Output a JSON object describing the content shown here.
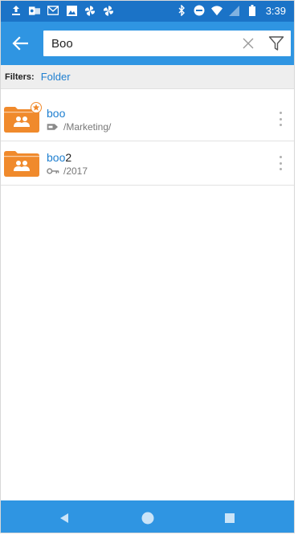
{
  "status_bar": {
    "time": "3:39",
    "left_icons": [
      "upload-icon",
      "outlook-icon",
      "gmail-icon",
      "image-icon",
      "pinwheel-icon",
      "pinwheel-icon"
    ],
    "right_icons": [
      "bluetooth-icon",
      "do-not-disturb-icon",
      "wifi-icon",
      "signal-icon",
      "battery-icon"
    ]
  },
  "app_bar": {
    "search_value": "Boo",
    "back_icon": "arrow-left-icon",
    "clear_icon": "close-icon",
    "filter_icon": "filter-icon"
  },
  "filters": {
    "label": "Filters:",
    "value": "Folder"
  },
  "results": [
    {
      "title_match": "boo",
      "title_rest": "",
      "path": "/Marketing/",
      "folder_icon": "shared-folder-icon",
      "badge": "favorite-star-icon",
      "path_icon": "label-icon"
    },
    {
      "title_match": "boo",
      "title_rest": "2",
      "path": "/2017",
      "folder_icon": "shared-folder-icon",
      "badge": "",
      "path_icon": "key-icon"
    }
  ],
  "colors": {
    "status_bar": "#1b73c7",
    "app_bar": "#2f95e2",
    "accent": "#1e7fd0",
    "folder": "#f08a2c"
  }
}
